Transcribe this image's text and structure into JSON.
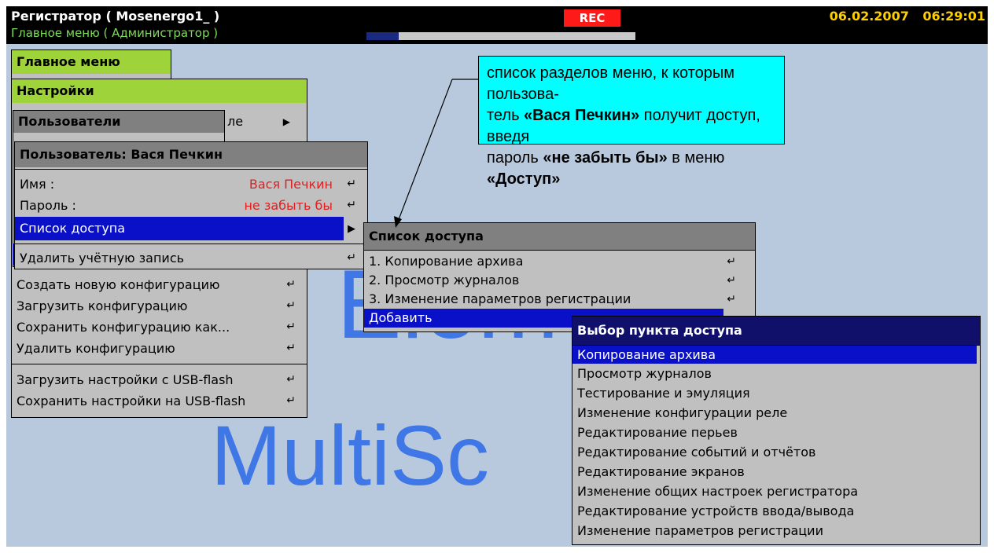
{
  "header": {
    "app_title": "Регистратор ( Mosenergo1_ )",
    "subtitle": "Главное меню ( Администратор )",
    "rec_label": "REC",
    "date": "06.02.2007",
    "time": "06:29:01",
    "progress": 0.12
  },
  "watermark": {
    "line1": "Elem",
    "line2": "MultiSc"
  },
  "main_menu": {
    "title": "Главное меню"
  },
  "settings_menu": {
    "title": "Настройки",
    "peek_text": "ле",
    "items": [
      "Создать новую конфигурацию",
      "Загрузить конфигурацию",
      "Сохранить конфигурацию как...",
      "Удалить конфигурацию",
      "Загрузить настройки с USB-flash",
      "Сохранить настройки на USB-flash"
    ]
  },
  "users_menu": {
    "title": "Пользователи"
  },
  "user_menu": {
    "title": "Пользователь: Вася Печкин",
    "name_label": "Имя :",
    "name_value": "Вася Печкин",
    "password_label": "Пароль :",
    "password_value": "не забыть бы",
    "access_list": "Список доступа",
    "delete_account": "Удалить учётную запись"
  },
  "access_list_menu": {
    "title": "Список доступа",
    "items": [
      "1. Копирование архива",
      "2. Просмотр журналов",
      "3. Изменение параметров регистрации"
    ],
    "add": "Добавить"
  },
  "access_choice_menu": {
    "title": "Выбор пункта доступа",
    "items": [
      "Копирование архива",
      "Просмотр журналов",
      "Тестирование и эмуляция",
      "Изменение конфигурации реле",
      "Редактирование перьев",
      "Редактирование событий и отчётов",
      "Редактирование экранов",
      "Изменение общих настроек регистратора",
      "Редактирование устройств ввода/вывода",
      "Изменение параметров регистрации"
    ]
  },
  "callout": {
    "t1": "список разделов меню, к которым пользова-",
    "t2": "тель ",
    "b1": "«Вася Печкин»",
    "t3": " получит доступ, введя",
    "t4": "пароль ",
    "b2": "«не забыть бы»",
    "t5": " в меню ",
    "b3": "«Доступ»"
  },
  "colors": {
    "screen_bg": "#b9c9dd",
    "header_green": "#9ed33a",
    "selection_blue": "#0a10c8",
    "rec_red": "#ff1a1a",
    "clock_yellow": "#ffd000",
    "callout_cyan": "#00ffff"
  }
}
